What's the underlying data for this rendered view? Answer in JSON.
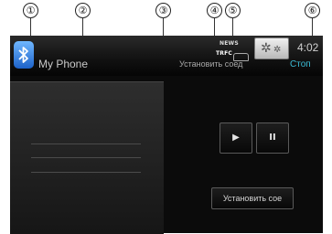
{
  "callouts": [
    "①",
    "②",
    "③",
    "④",
    "⑤",
    "⑥"
  ],
  "header": {
    "device_name": "My Phone",
    "connection_status": "Установить соед",
    "news_label": "NEWS",
    "trfc_label": "TRFC",
    "clock": "4:02",
    "stop_label": "Стоп"
  },
  "icons": {
    "bluetooth": "bluetooth-icon",
    "news": "news-icon",
    "traffic": "traffic-icon",
    "car": "car-icon",
    "settings": "gear-icon",
    "play": "play-icon",
    "pause": "pause-icon"
  },
  "controls": {
    "play_symbol": "▶",
    "pause_symbol": "II",
    "connect_label": "Установить сое"
  },
  "colors": {
    "accent_stop": "#3bbcd6",
    "bluetooth": "#2f7fe0"
  }
}
